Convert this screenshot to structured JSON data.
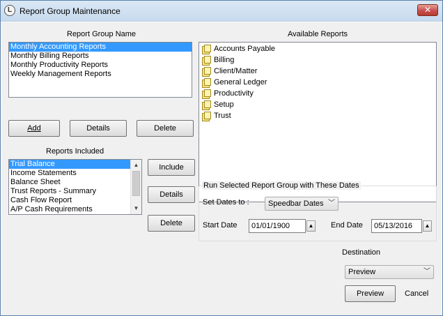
{
  "window": {
    "title": "Report Group Maintenance",
    "close_symbol": "✕"
  },
  "group_name": {
    "label": "Report Group Name",
    "items": [
      "Monthly Accounting Reports",
      "Monthly Billing Reports",
      "Monthly Productivity Reports",
      "Weekly Management Reports"
    ]
  },
  "group_buttons": {
    "add": "Add",
    "details": "Details",
    "delete": "Delete"
  },
  "available": {
    "label": "Available Reports",
    "items": [
      "Accounts Payable",
      "Billing",
      "Client/Matter",
      "General Ledger",
      "Productivity",
      "Setup",
      "Trust"
    ]
  },
  "included": {
    "label": "Reports Included",
    "items": [
      "Trial Balance",
      "Income Statements",
      "Balance Sheet",
      "Trust Reports - Summary",
      "Cash Flow Report",
      "A/P Cash Requirements"
    ]
  },
  "included_buttons": {
    "include": "Include",
    "details": "Details",
    "delete": "Delete"
  },
  "run_group": {
    "title": "Run Selected Report Group with These Dates",
    "set_dates_label": "Set Dates to :",
    "set_dates_value": "Speedbar Dates",
    "start_label": "Start Date",
    "start_value": "01/01/1900",
    "end_label": "End Date",
    "end_value": "05/13/2016"
  },
  "destination": {
    "label": "Destination",
    "value": "Preview"
  },
  "actions": {
    "preview": "Preview",
    "cancel": "Cancel"
  }
}
